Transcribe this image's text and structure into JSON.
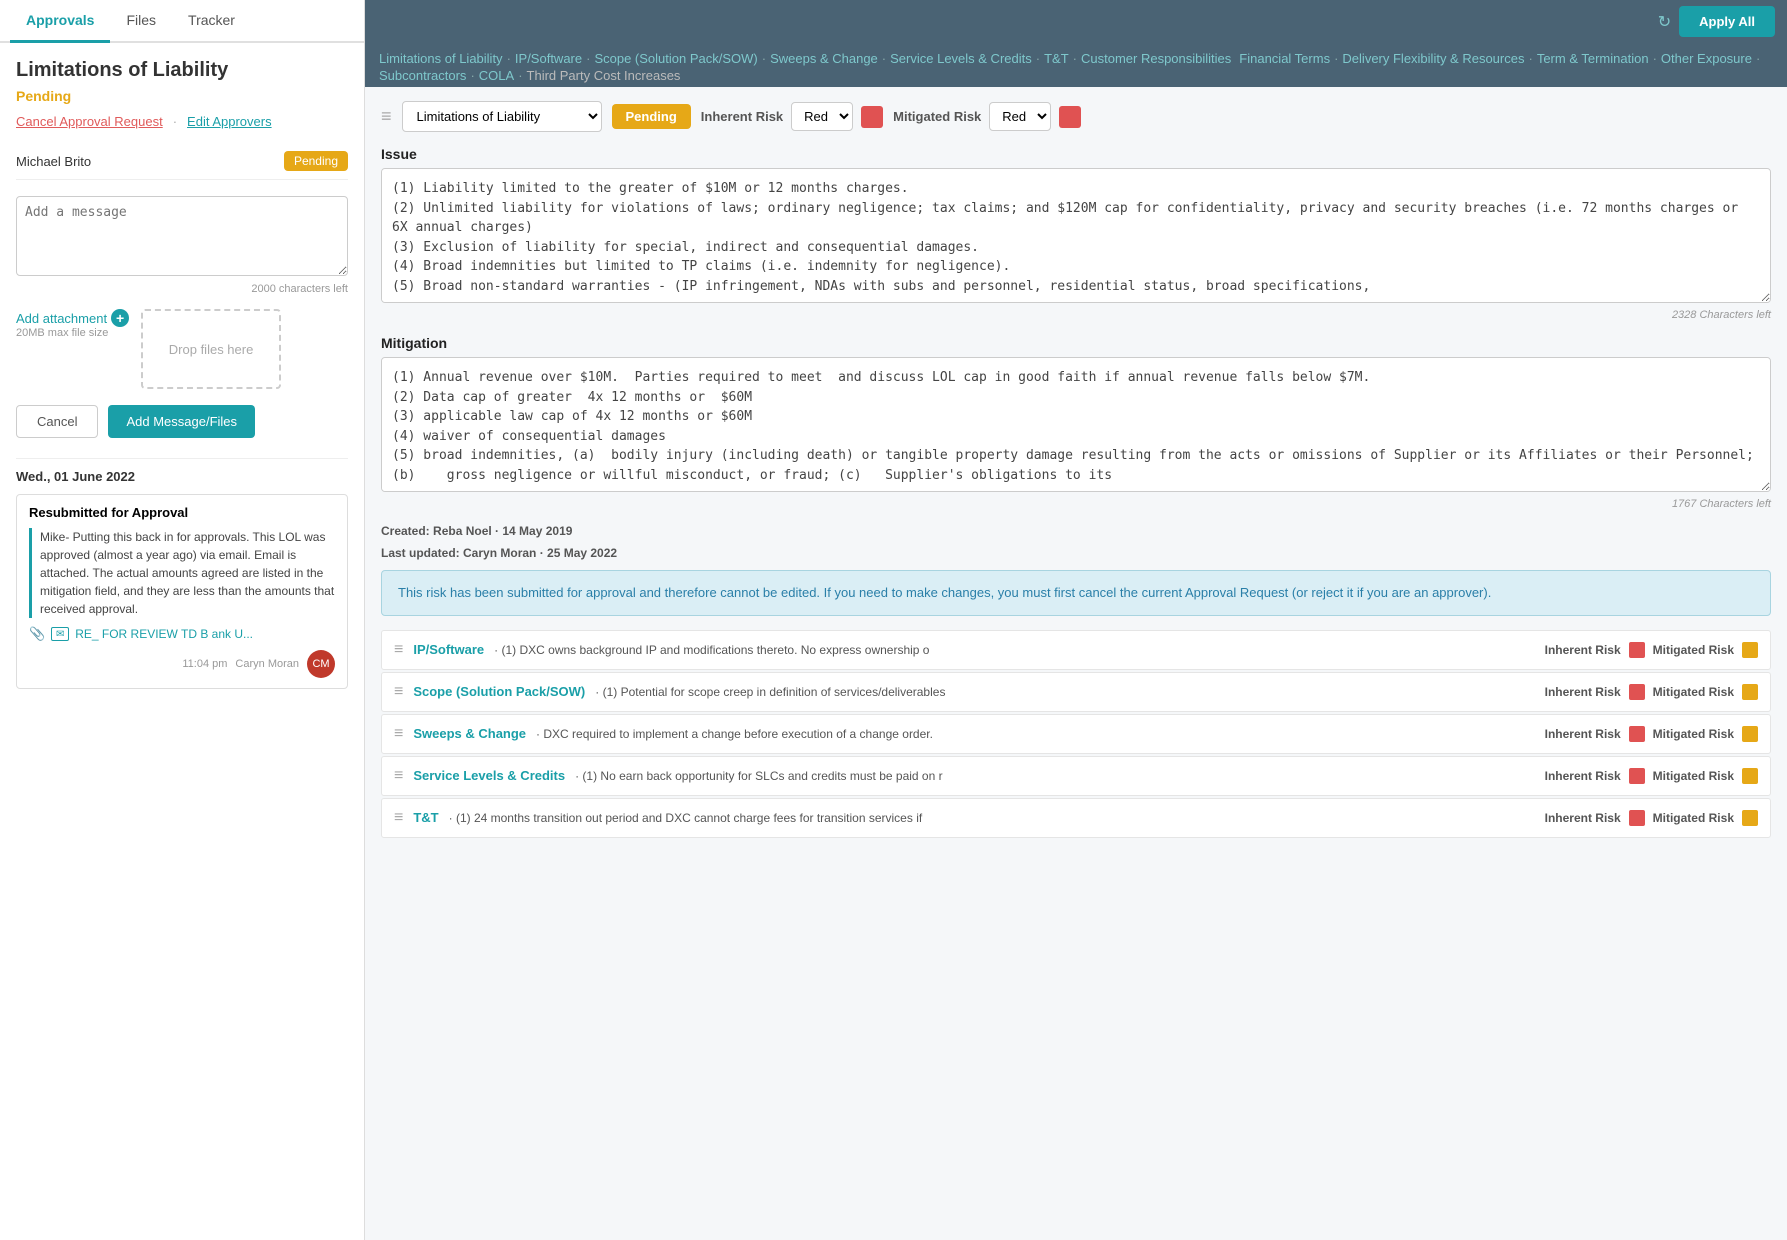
{
  "leftPanel": {
    "tabs": [
      {
        "label": "Approvals",
        "active": true
      },
      {
        "label": "Files",
        "active": false
      },
      {
        "label": "Tracker",
        "active": false
      }
    ],
    "title": "Limitations of Liability",
    "status": "Pending",
    "actions": {
      "cancel": "Cancel Approval Request",
      "edit": "Edit Approvers"
    },
    "approver": {
      "name": "Michael Brito",
      "status": "Pending"
    },
    "message": {
      "placeholder": "Add a message",
      "charsLeft": "2000 characters left"
    },
    "attachment": {
      "label": "Add attachment",
      "maxSize": "20MB max file size",
      "dropZone": "Drop files here"
    },
    "buttons": {
      "cancel": "Cancel",
      "addMessage": "Add Message/Files"
    },
    "timeline": {
      "date": "Wed., 01 June 2022",
      "card": {
        "title": "Resubmitted for Approval",
        "body": "Mike- Putting this back in for approvals.  This LOL was approved (almost a year ago) via email.  Email is attached.  The actual amounts agreed are listed in the mitigation field, and they are less than the amounts that received approval.",
        "emailLink": "RE_ FOR REVIEW TD B ank U...",
        "author": "Caryn Moran",
        "time": "11:04 pm"
      }
    }
  },
  "rightPanel": {
    "topBar": {
      "applyAll": "Apply All"
    },
    "navLinks": [
      {
        "label": "Limitations of Liability",
        "active": true
      },
      {
        "label": "IP/Software",
        "active": true
      },
      {
        "label": "Scope (Solution Pack/SOW)",
        "active": true
      },
      {
        "label": "Sweeps & Change",
        "active": true
      },
      {
        "label": "Service Levels & Credits",
        "active": true
      },
      {
        "label": "T&T",
        "active": true
      },
      {
        "label": "Customer Responsibilities",
        "active": true
      },
      {
        "label": "Financial Terms",
        "active": true
      },
      {
        "label": "Delivery Flexibility & Resources",
        "active": true
      },
      {
        "label": "Term & Termination",
        "active": true
      },
      {
        "label": "Other Exposure",
        "active": true
      },
      {
        "label": "Subcontractors",
        "active": true
      },
      {
        "label": "COLA",
        "active": true
      },
      {
        "label": "Third Party Cost Increases",
        "active": false
      }
    ],
    "issueHeader": {
      "sectionLabel": "Limitations of Liability",
      "statusLabel": "Pending",
      "inherentRiskLabel": "Inherent Risk",
      "inherentRiskValue": "Red",
      "mitigatedRiskLabel": "Mitigated Risk",
      "mitigatedRiskValue": "Red"
    },
    "issue": {
      "label": "Issue",
      "text": "(1) Liability limited to the greater of $10M or 12 months charges.\n(2) Unlimited liability for violations of laws; ordinary negligence; tax claims; and $120M cap for confidentiality, privacy and security breaches (i.e. 72 months charges or 6X annual charges)\n(3) Exclusion of liability for special, indirect and consequential damages.\n(4) Broad indemnities but limited to TP claims (i.e. indemnity for negligence).\n(5) Broad non-standard warranties - (IP infringement, NDAs with subs and personnel, residential status, broad specifications,",
      "charsLeft": "2328 Characters left"
    },
    "mitigation": {
      "label": "Mitigation",
      "text": "(1) Annual revenue over $10M.  Parties required to meet  and discuss LOL cap in good faith if annual revenue falls below $7M.\n(2) Data cap of greater  4x 12 months or  $60M\n(3) applicable law cap of 4x 12 months or $60M\n(4) waiver of consequential damages\n(5) broad indemnities, (a)  bodily injury (including death) or tangible property damage resulting from the acts or omissions of Supplier or its Affiliates or their Personnel; (b)    gross negligence or willful misconduct, or fraud; (c)   Supplier's obligations to its",
      "charsLeft": "1767 Characters left"
    },
    "meta": {
      "created": "Created:",
      "createdValue": "Reba Noel · 14 May 2019",
      "lastUpdated": "Last updated:",
      "lastUpdatedValue": "Caryn Moran · 25 May 2022"
    },
    "infoBanner": "This risk has been submitted for approval and therefore cannot be edited. If you need to make changes, you must first cancel the current Approval Request (or reject it if you are an approver).",
    "riskRows": [
      {
        "title": "IP/Software",
        "desc": "· (1) DXC owns background IP and modifications thereto. No express ownership o",
        "inherentRisk": "red",
        "mitigatedRisk": "orange"
      },
      {
        "title": "Scope (Solution Pack/SOW)",
        "desc": "· (1) Potential for scope creep in definition of services/deliverables",
        "inherentRisk": "red",
        "mitigatedRisk": "orange"
      },
      {
        "title": "Sweeps & Change",
        "desc": "· DXC required to implement a change before execution of a change order.",
        "inherentRisk": "red",
        "mitigatedRisk": "orange"
      },
      {
        "title": "Service Levels & Credits",
        "desc": "· (1) No earn back opportunity for SLCs and credits must be paid on r",
        "inherentRisk": "red",
        "mitigatedRisk": "orange"
      },
      {
        "title": "T&T",
        "desc": "· (1) 24 months transition out period and DXC cannot charge fees for transition services if",
        "inherentRisk": "red",
        "mitigatedRisk": "orange"
      }
    ]
  }
}
